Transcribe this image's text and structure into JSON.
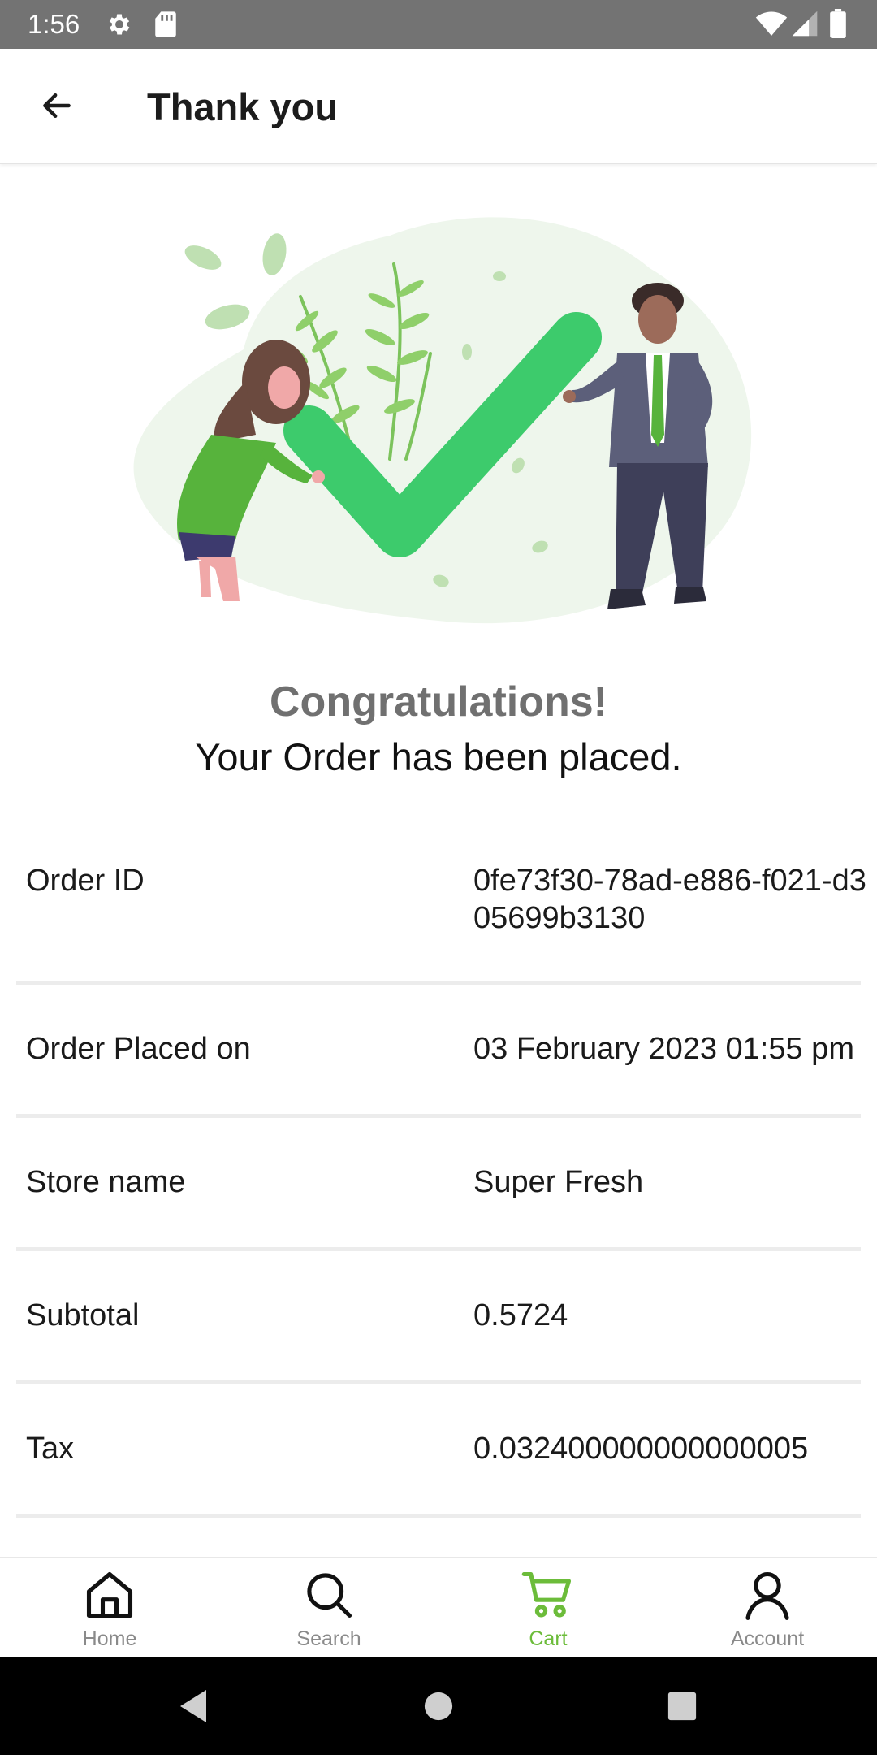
{
  "status_bar": {
    "time": "1:56",
    "icons": [
      "gear-icon",
      "sd-card-icon",
      "wifi-icon",
      "signal-icon",
      "battery-icon"
    ]
  },
  "app_bar": {
    "back_icon": "arrow-left-icon",
    "title": "Thank you"
  },
  "illustration": {
    "name": "order-success-illustration",
    "accent": "#3dcb6c"
  },
  "message": {
    "heading": "Congratulations!",
    "subtext": "Your Order has been placed."
  },
  "details": [
    {
      "label": "Order ID",
      "value": "0fe73f30-78ad-e886-f021-d305699b3130"
    },
    {
      "label": "Order Placed on",
      "value": "03 February 2023 01:55 pm"
    },
    {
      "label": "Store name",
      "value": "Super Fresh"
    },
    {
      "label": "Subtotal",
      "value": "0.5724"
    },
    {
      "label": "Tax",
      "value": "0.032400000000000005"
    }
  ],
  "bottom_nav": {
    "items": [
      {
        "label": "Home",
        "icon": "home-icon",
        "active": false
      },
      {
        "label": "Search",
        "icon": "search-icon",
        "active": false
      },
      {
        "label": "Cart",
        "icon": "cart-icon",
        "active": true
      },
      {
        "label": "Account",
        "icon": "account-icon",
        "active": false
      }
    ],
    "active_color": "#6cbc3a",
    "inactive_color": "#8a8a8a"
  },
  "system_nav": {
    "icons": [
      "back-triangle-icon",
      "home-circle-icon",
      "recents-square-icon"
    ]
  }
}
